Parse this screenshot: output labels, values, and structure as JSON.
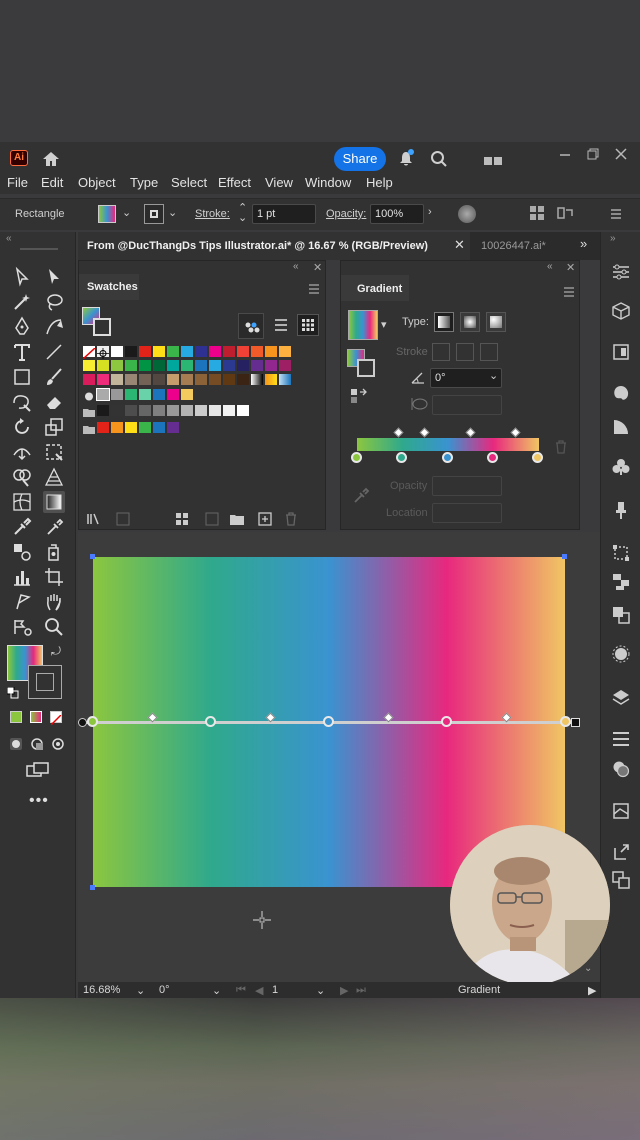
{
  "app": {
    "logo": "Ai",
    "share_label": "Share"
  },
  "menu": [
    "File",
    "Edit",
    "Object",
    "Type",
    "Select",
    "Effect",
    "View",
    "Window",
    "Help"
  ],
  "control_bar": {
    "selection_type": "Rectangle",
    "stroke_label": "Stroke:",
    "stroke_value": "1 pt",
    "opacity_label": "Opacity:",
    "opacity_value": "100%"
  },
  "tabs": {
    "active": "From @DucThangDs Tips Illustrator.ai* @ 16.67 % (RGB/Preview)",
    "inactive": "10026447.ai*"
  },
  "swatches_panel": {
    "title": "Swatches"
  },
  "gradient_panel": {
    "title": "Gradient",
    "type_label": "Type:",
    "stroke_label": "Stroke",
    "angle_value": "0°",
    "opacity_label": "Opacity",
    "location_label": "Location",
    "stop_colors": [
      "#8cc63f",
      "#2fa98c",
      "#3a93d0",
      "#e8287e",
      "#f0c663"
    ]
  },
  "status_bar": {
    "zoom": "16.68%",
    "rotation": "0°",
    "artboard_number": "1",
    "current_tool": "Gradient"
  },
  "colors": {
    "accent": "#1473e6",
    "panel_bg": "#323232",
    "canvas_bg": "#3c3c3c"
  }
}
